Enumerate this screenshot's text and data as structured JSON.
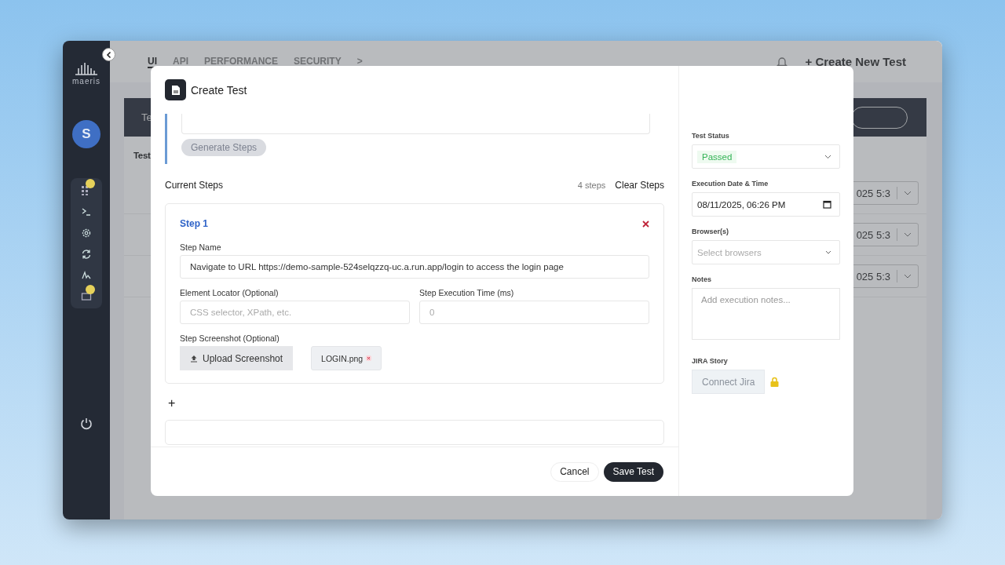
{
  "sidebar": {
    "logo_text": "maeris",
    "avatar": "S",
    "items": [
      {
        "kind": "grid",
        "locked": true
      },
      {
        "kind": "terminal",
        "locked": false
      },
      {
        "kind": "gear",
        "locked": false
      },
      {
        "kind": "refresh",
        "locked": false
      },
      {
        "kind": "signature",
        "locked": false
      },
      {
        "kind": "table",
        "locked": true
      }
    ]
  },
  "background": {
    "tabs": [
      {
        "label": "UI",
        "selected": true
      },
      {
        "label": "API",
        "selected": false
      },
      {
        "label": "PERFORMANCE",
        "selected": false
      },
      {
        "label": "SECURITY",
        "selected": false
      }
    ],
    "more_tabs": ">",
    "create_button": "+ Create New Test",
    "header_cell": "Te",
    "section_title": "Test",
    "rows": [
      {
        "date": "025 5:3"
      },
      {
        "date": "025 5:3"
      },
      {
        "date": "025 5:3"
      }
    ]
  },
  "modal": {
    "title": "Create Test",
    "generate_steps": {
      "label": "Generate Steps",
      "disabled": true
    },
    "current_steps": "Current Steps",
    "steps_count": "4 steps",
    "clear_steps": "Clear Steps",
    "steps": [
      {
        "title": "Step 1",
        "name_label": "Step Name",
        "name_value": "Navigate to URL https://demo-sample-524selqzzq-uc.a.run.app/login to access the login page",
        "locator_label": "Element Locator (Optional)",
        "locator_placeholder": "CSS selector, XPath, etc.",
        "time_label": "Step Execution Time (ms)",
        "time_placeholder": "0",
        "screenshot_label": "Step Screenshot (Optional)",
        "upload_button": "Upload Screenshot",
        "file_name": "LOGIN.png"
      }
    ],
    "add_step": "+",
    "cancel": "Cancel",
    "save": "Save Test",
    "side": {
      "status_label": "Test Status",
      "status_value": "Passed",
      "datetime_label": "Execution Date & Time",
      "datetime_value": "08/11/2025, 06:26 PM",
      "browsers_label": "Browser(s)",
      "browsers_placeholder": "Select browsers",
      "notes_label": "Notes",
      "notes_placeholder": "Add execution notes...",
      "jira_label": "JIRA Story",
      "jira_button": {
        "label": "Connect Jira",
        "disabled": true,
        "locked": true
      }
    }
  }
}
